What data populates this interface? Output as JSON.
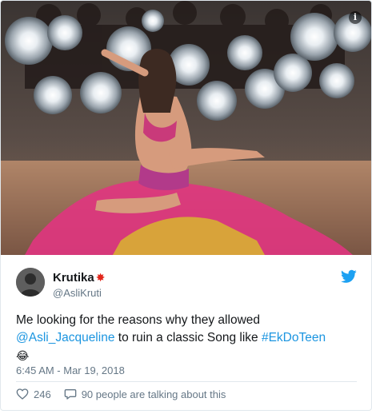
{
  "tweet": {
    "display_name": "Krutika",
    "name_emoji_icon": "collision-icon",
    "handle": "@AsliKruti",
    "text_before": "Me looking for the reasons why they allowed ",
    "mention": "@Asli_Jacqueline",
    "text_middle": " to ruin a classic Song like ",
    "hashtag": "#EkDoTeen",
    "emoji": "😂",
    "timestamp": "6:45 AM - Mar 19, 2018",
    "likes": "246",
    "conversation": "90 people are talking about this"
  },
  "icons": {
    "info": "info-icon",
    "platform": "twitter-bird-icon",
    "like": "heart-icon",
    "reply": "speech-bubble-icon"
  },
  "colors": {
    "link": "#1b95e0",
    "secondary_text": "#657786",
    "brand": "#1da1f2"
  }
}
